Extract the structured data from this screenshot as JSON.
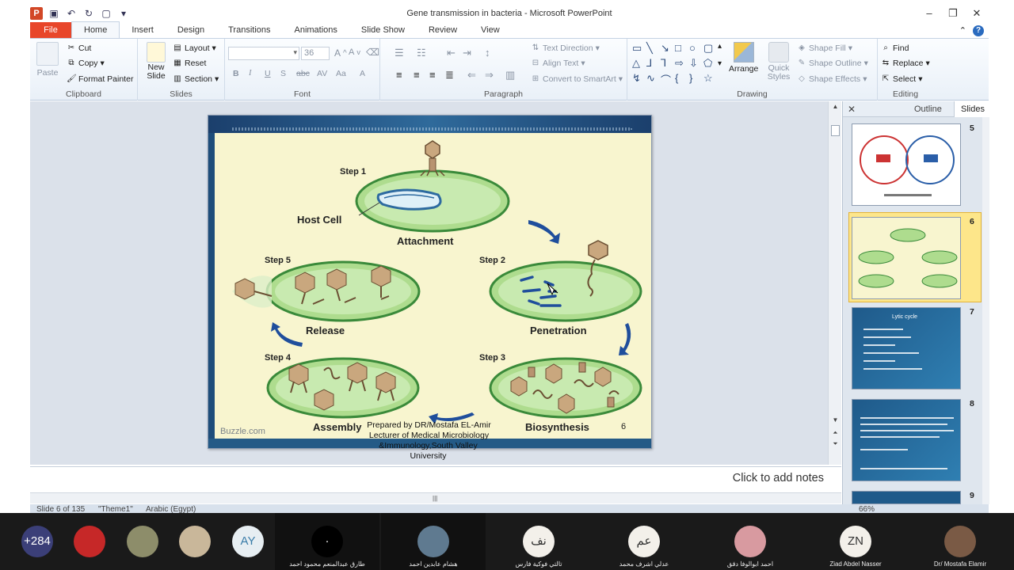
{
  "window": {
    "title": "Gene transmission in bacteria  -  Microsoft PowerPoint",
    "app_badge": "P",
    "controls": [
      "–",
      "❐",
      "✕"
    ]
  },
  "tabs": [
    "File",
    "Home",
    "Insert",
    "Design",
    "Transitions",
    "Animations",
    "Slide Show",
    "Review",
    "View"
  ],
  "active_tab": "Home",
  "ribbon": {
    "clipboard": {
      "label": "Clipboard",
      "paste": "Paste",
      "cut": "Cut",
      "copy": "Copy",
      "format_painter": "Format Painter"
    },
    "slides": {
      "label": "Slides",
      "new_slide": "New Slide",
      "layout": "Layout",
      "reset": "Reset",
      "section": "Section"
    },
    "font": {
      "label": "Font",
      "font_name": "",
      "font_size": "36",
      "bold": "B",
      "italic": "I",
      "underline": "U",
      "shadow": "S",
      "strike": "abc",
      "spacing": "AV",
      "case": "Aa",
      "color": "A"
    },
    "paragraph": {
      "label": "Paragraph",
      "text_direction": "Text Direction",
      "align_text": "Align Text",
      "convert": "Convert to SmartArt"
    },
    "drawing": {
      "label": "Drawing",
      "arrange": "Arrange",
      "quick_styles": "Quick Styles",
      "shape_fill": "Shape Fill",
      "shape_outline": "Shape Outline",
      "shape_effects": "Shape Effects"
    },
    "editing": {
      "label": "Editing",
      "find": "Find",
      "replace": "Replace",
      "select": "Select"
    }
  },
  "slide": {
    "steps": [
      "Step 1",
      "Step 2",
      "Step 3",
      "Step 4",
      "Step 5"
    ],
    "labels": {
      "host_cell": "Host Cell",
      "attachment": "Attachment",
      "penetration": "Penetration",
      "biosynthesis": "Biosynthesis",
      "assembly": "Assembly",
      "release": "Release"
    },
    "watermark": "Buzzle.com",
    "number": "6",
    "prepared": [
      "Prepared by DR/Mostafa EL-Amir",
      "Lecturer of Medical Microbiology",
      "&Immunology,South Valley",
      "University"
    ]
  },
  "notes_placeholder": "Click to add notes",
  "pane": {
    "tabs": [
      "Outline",
      "Slides"
    ],
    "close": "✕",
    "thumbnails": [
      {
        "num": "5"
      },
      {
        "num": "6",
        "selected": true
      },
      {
        "num": "7",
        "title": "Lytic cycle"
      },
      {
        "num": "8"
      },
      {
        "num": "9"
      }
    ]
  },
  "status": {
    "slide": "Slide 6 of 135",
    "theme": "\"Theme1\"",
    "language": "Arabic (Egypt)",
    "zoom": "66%"
  },
  "participants": [
    {
      "label": "+284",
      "name": "",
      "color": "#3b3f78"
    },
    {
      "label": "",
      "name": "",
      "color": "#c62828"
    },
    {
      "label": "",
      "name": "",
      "color": "#8d8d6a"
    },
    {
      "label": "",
      "name": "",
      "color": "#c9b79a"
    },
    {
      "label": "AY",
      "name": "",
      "color": "#e7eef2",
      "text_color": "#3a7ca8"
    },
    {
      "label": "·",
      "name": "طارق عبدالمنعم محمود احمد",
      "color": "#000"
    },
    {
      "label": "",
      "name": "هشام عابدين احمد",
      "color": "#5f7a90"
    },
    {
      "label": "نف",
      "name": "تالتي فوكية فارس",
      "color": "#f3f0ea",
      "text_color": "#333"
    },
    {
      "label": "عم",
      "name": "عدلي اشرف محمد",
      "color": "#f3f0ea",
      "text_color": "#333"
    },
    {
      "label": "",
      "name": "احمد ابوالوفا دقق",
      "color": "#d89aa0"
    },
    {
      "label": "ZN",
      "name": "Ziad Abdel Nasser",
      "color": "#f3f0ea",
      "text_color": "#333"
    },
    {
      "label": "",
      "name": "Dr/ Mostafa Elamir",
      "color": "#7a5a45"
    }
  ]
}
